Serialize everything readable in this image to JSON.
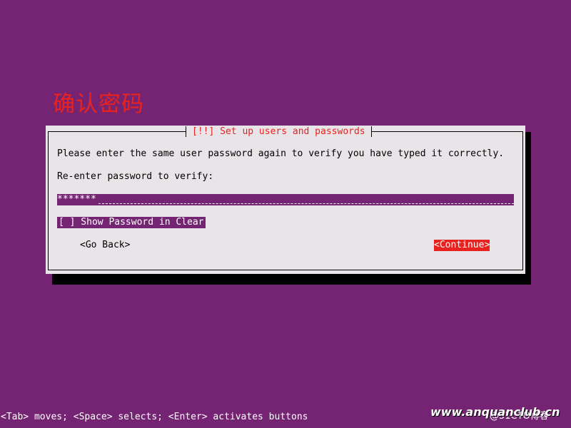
{
  "annotation": {
    "text": "确认密码"
  },
  "dialog": {
    "title": "[!!] Set up users and passwords",
    "prompt": "Please enter the same user password again to verify you have typed it correctly.",
    "field_label": "Re-enter password to verify:",
    "password_value": "*******",
    "show_password_option": "[ ] Show Password in Clear",
    "go_back_label": "<Go Back>",
    "continue_label": "<Continue>"
  },
  "status_bar": {
    "help_text": "<Tab> moves; <Space> selects; <Enter> activates buttons"
  },
  "watermark": {
    "site": "www.anquanclub.cn",
    "blog": "@51CTO博客"
  },
  "colors": {
    "background": "#742472",
    "dialog_bg": "#e8e4e8",
    "title_red": "#e8231f",
    "highlight": "#742472",
    "focused_button": "#e8231f"
  }
}
